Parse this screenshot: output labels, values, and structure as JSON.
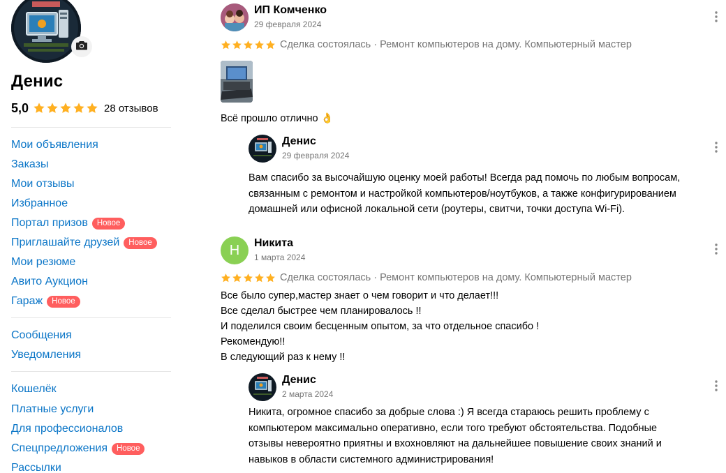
{
  "profile": {
    "name": "Денис",
    "rating": "5,0",
    "stars": 5,
    "reviews_count": "28 отзывов"
  },
  "sidebar": {
    "group1": [
      {
        "label": "Мои объявления",
        "badge": ""
      },
      {
        "label": "Заказы",
        "badge": ""
      },
      {
        "label": "Мои отзывы",
        "badge": ""
      },
      {
        "label": "Избранное",
        "badge": ""
      },
      {
        "label": "Портал призов",
        "badge": "Новое"
      },
      {
        "label": "Приглашайте друзей",
        "badge": "Новое"
      },
      {
        "label": "Мои резюме",
        "badge": ""
      },
      {
        "label": "Авито Аукцион",
        "badge": ""
      },
      {
        "label": "Гараж",
        "badge": "Новое"
      }
    ],
    "group2": [
      {
        "label": "Сообщения"
      },
      {
        "label": "Уведомления"
      }
    ],
    "group3": [
      {
        "label": "Кошелёк",
        "badge": ""
      },
      {
        "label": "Платные услуги",
        "badge": ""
      },
      {
        "label": "Для профессионалов",
        "badge": ""
      },
      {
        "label": "Спецпредложения",
        "badge": "Новое"
      },
      {
        "label": "Рассылки",
        "badge": ""
      }
    ]
  },
  "reviews": [
    {
      "author": "ИП Комченко",
      "date": "29 февраля 2024",
      "stars": 5,
      "meta": "Сделка состоялась · Ремонт компьютеров на дому. Компьютерный мастер",
      "text_lines": [
        "Всё прошло отлично 👌"
      ],
      "reply": {
        "author": "Денис",
        "date": "29 февраля 2024",
        "text_lines": [
          "Вам спасибо за высочайшую оценку моей работы! Всегда рад помочь по любым вопросам,",
          "связанным с ремонтом и настройкой компьютеров/ноутбуков, а также конфигурированием",
          "домашней или офисной локальной сети (роутеры, свитчи, точки доступа Wi-Fi)."
        ]
      }
    },
    {
      "author": "Никита",
      "avatar_letter": "Н",
      "date": "1 марта 2024",
      "stars": 5,
      "meta": "Сделка состоялась · Ремонт компьютеров на дому. Компьютерный мастер",
      "text_lines": [
        "Все было супер,мастер знает о чем говорит и что делает!!!",
        "Все сделал быстрее чем планировалось !!",
        "И поделился своим бесценным опытом, за что отдельное спасибо !",
        "Рекомендую!!",
        "В следующий раз к нему !!"
      ],
      "reply": {
        "author": "Денис",
        "date": "2 марта 2024",
        "text_lines": [
          "Никита, огромное спасибо за добрые слова :) Я всегда стараюсь решить проблему с",
          "компьютером максимально оперативно, если того требуют обстоятельства. Подобные",
          "отзывы невероятно приятны и вхохновляют на дальнейшее повышение своих знаний и",
          "навыков в области системного администрирования!"
        ]
      }
    }
  ],
  "colors": {
    "link": "#0a75c7",
    "star": "#ffb021",
    "badge": "#ff5e5e",
    "muted": "#757575",
    "letter_avatar": "#8ad054"
  },
  "icons": {
    "camera": "camera-icon",
    "more": "more-vertical-icon",
    "star": "star-icon"
  }
}
